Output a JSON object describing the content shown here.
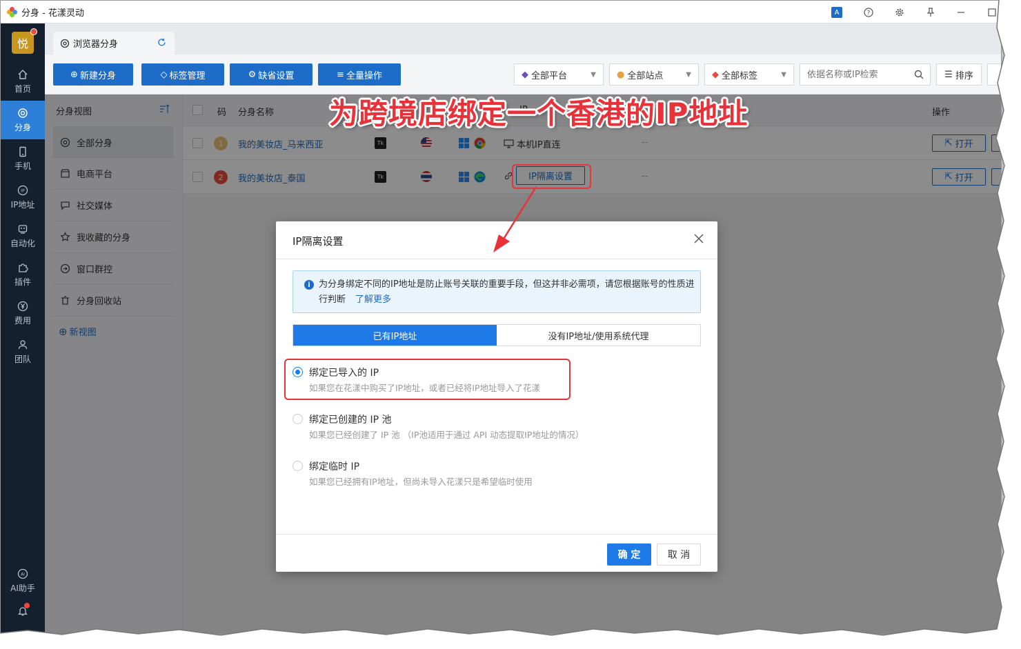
{
  "window": {
    "title": "分身 - 花漾灵动"
  },
  "leftnav": {
    "avatar": "悦",
    "items": [
      {
        "label": "首页",
        "icon": "home-icon"
      },
      {
        "label": "分身",
        "icon": "browser-icon"
      },
      {
        "label": "手机",
        "icon": "phone-icon"
      },
      {
        "label": "IP地址",
        "icon": "ip-icon"
      },
      {
        "label": "自动化",
        "icon": "robot-icon"
      },
      {
        "label": "插件",
        "icon": "puzzle-icon"
      },
      {
        "label": "费用",
        "icon": "yen-icon"
      },
      {
        "label": "团队",
        "icon": "team-icon"
      }
    ],
    "ai": "AI助手"
  },
  "tab": {
    "label": "浏览器分身"
  },
  "toolbar": {
    "new": "新建分身",
    "tags": "标签管理",
    "defaults": "缺省设置",
    "bulk": "全量操作",
    "platform": "全部平台",
    "site": "全部站点",
    "label": "全部标签",
    "search_placeholder": "依据名称或IP检索",
    "sort": "排序"
  },
  "viewpanel": {
    "title": "分身视图",
    "items": [
      "全部分身",
      "电商平台",
      "社交媒体",
      "我收藏的分身",
      "窗口群控",
      "分身回收站"
    ],
    "new_view": "新视图"
  },
  "table": {
    "headers": {
      "code": "码",
      "name": "分身名称",
      "ip": "IP",
      "ops": "操作"
    },
    "rows": [
      {
        "seq": "1",
        "name": "我的美妆店_马来西亚",
        "tk": "Tk",
        "ip": "本机IP直连",
        "dash": "--",
        "open": "打开"
      },
      {
        "seq": "2",
        "name": "我的美妆店_泰国",
        "tk": "Tk",
        "ip": "IP隔离设置",
        "dash": "--",
        "open": "打开"
      }
    ]
  },
  "annotation": {
    "text": "为跨境店绑定一个香港的IP地址"
  },
  "dialog": {
    "title": "IP隔离设置",
    "info": "为分身绑定不同的IP地址是防止账号关联的重要手段，但这并非必需项，请您根据账号的性质进行判断",
    "info_link": "了解更多",
    "tabs": [
      "已有IP地址",
      "没有IP地址/使用系统代理"
    ],
    "options": [
      {
        "title": "绑定已导入的 IP",
        "desc": "如果您在花漾中购买了IP地址，或者已经将IP地址导入了花漾",
        "selected": true
      },
      {
        "title": "绑定已创建的 IP 池",
        "desc": "如果您已经创建了 IP 池 （IP池适用于通过 API 动态提取IP地址的情况）",
        "selected": false
      },
      {
        "title": "绑定临时 IP",
        "desc": "如果您已经拥有IP地址，但尚未导入花漾只是希望临时使用",
        "selected": false
      }
    ],
    "ok": "确 定",
    "cancel": "取 消"
  },
  "colors": {
    "accent": "#1d6cc7",
    "annotation": "#e8323a",
    "nav_bg": "#15202e"
  }
}
